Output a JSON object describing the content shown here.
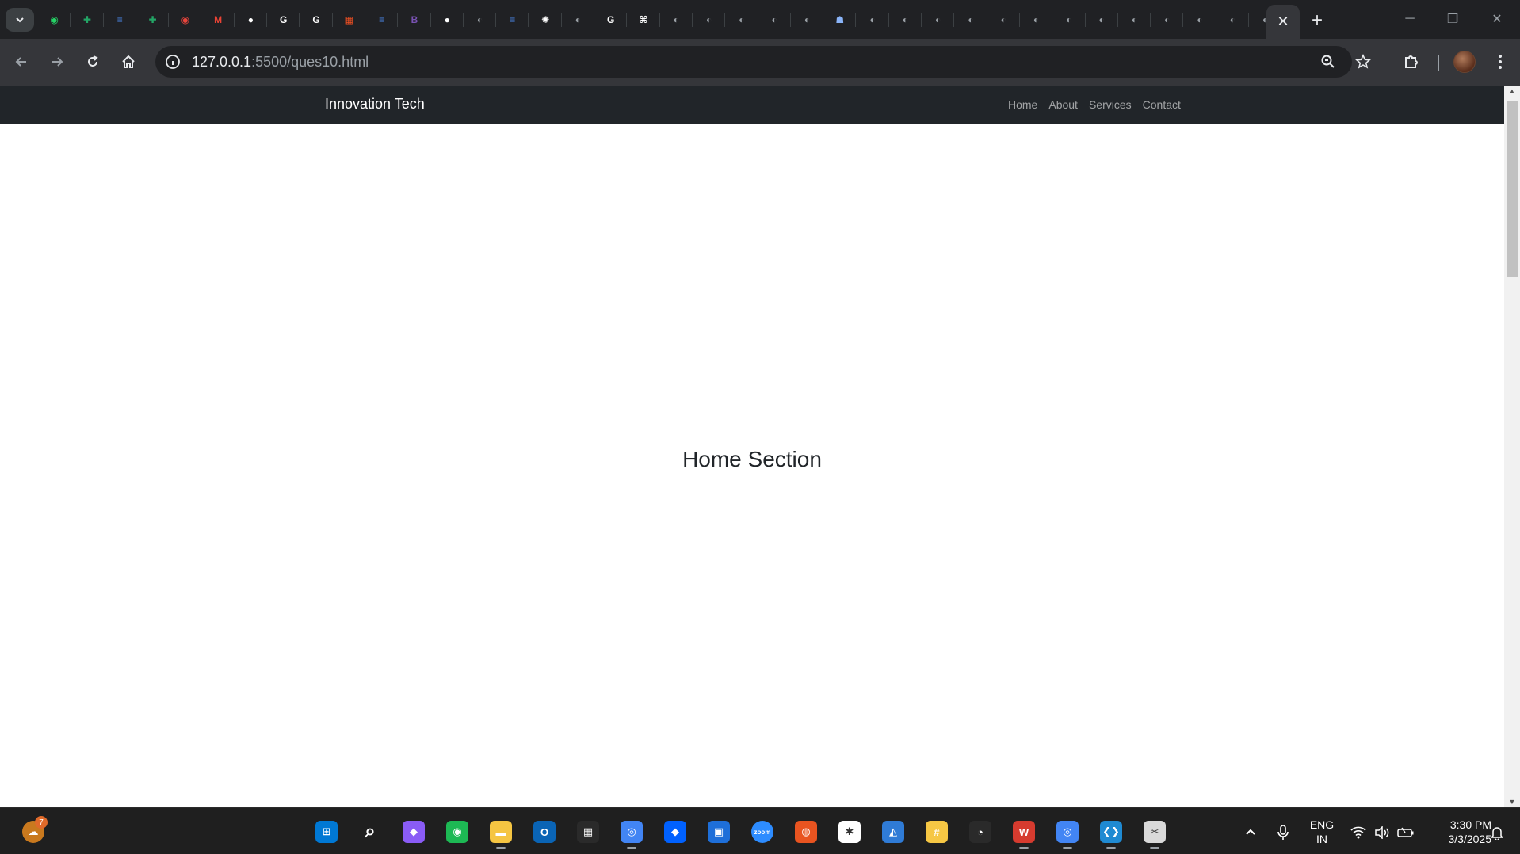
{
  "browser": {
    "active_tab_close_glyph": "✕",
    "new_tab_glyph": "+",
    "window_controls": {
      "minimize": "─",
      "restore": "❐",
      "close": "✕"
    },
    "pinned_tabs": [
      {
        "icon": "whatsapp-icon",
        "color": "#25d366",
        "glyph": "◉"
      },
      {
        "icon": "sheets-icon",
        "color": "#23a566",
        "glyph": "✚"
      },
      {
        "icon": "docs-icon",
        "color": "#4a86e8",
        "glyph": "≡"
      },
      {
        "icon": "sheets-icon",
        "color": "#23a566",
        "glyph": "✚"
      },
      {
        "icon": "record-icon",
        "color": "#e8453c",
        "glyph": "◉"
      },
      {
        "icon": "gmail-icon",
        "color": "#ea4335",
        "glyph": "M"
      },
      {
        "icon": "github-icon",
        "color": "#ffffff",
        "glyph": "●"
      },
      {
        "icon": "google-icon",
        "color": "#ffffff",
        "glyph": "G"
      },
      {
        "icon": "google-icon",
        "color": "#ffffff",
        "glyph": "G"
      },
      {
        "icon": "microsoft-icon",
        "color": "#f25022",
        "glyph": "▦"
      },
      {
        "icon": "docs-icon",
        "color": "#4a86e8",
        "glyph": "≡"
      },
      {
        "icon": "bootstrap-icon",
        "color": "#7952b3",
        "glyph": "B"
      },
      {
        "icon": "github-icon",
        "color": "#ffffff",
        "glyph": "●"
      },
      {
        "icon": "globe-icon",
        "color": "#9aa0a6",
        "glyph": "◐"
      },
      {
        "icon": "docs-icon",
        "color": "#4a86e8",
        "glyph": "≡"
      },
      {
        "icon": "openai-icon",
        "color": "#ffffff",
        "glyph": "✺"
      },
      {
        "icon": "globe-icon",
        "color": "#9aa0a6",
        "glyph": "◐"
      },
      {
        "icon": "google-icon",
        "color": "#ffffff",
        "glyph": "G"
      },
      {
        "icon": "perplexity-icon",
        "color": "#ffffff",
        "glyph": "⌘"
      },
      {
        "icon": "globe-icon",
        "color": "#9aa0a6",
        "glyph": "◐"
      },
      {
        "icon": "globe-icon",
        "color": "#9aa0a6",
        "glyph": "◐"
      },
      {
        "icon": "globe-icon",
        "color": "#9aa0a6",
        "glyph": "◐"
      },
      {
        "icon": "globe-icon",
        "color": "#9aa0a6",
        "glyph": "◐"
      },
      {
        "icon": "globe-icon",
        "color": "#9aa0a6",
        "glyph": "◐"
      },
      {
        "icon": "robot-icon",
        "color": "#8ab4f8",
        "glyph": "☗"
      },
      {
        "icon": "globe-icon",
        "color": "#9aa0a6",
        "glyph": "◐"
      },
      {
        "icon": "globe-icon",
        "color": "#9aa0a6",
        "glyph": "◐"
      },
      {
        "icon": "globe-icon",
        "color": "#9aa0a6",
        "glyph": "◐"
      },
      {
        "icon": "globe-icon",
        "color": "#9aa0a6",
        "glyph": "◐"
      },
      {
        "icon": "globe-icon",
        "color": "#9aa0a6",
        "glyph": "◐"
      },
      {
        "icon": "globe-icon",
        "color": "#9aa0a6",
        "glyph": "◐"
      },
      {
        "icon": "globe-icon",
        "color": "#9aa0a6",
        "glyph": "◐"
      },
      {
        "icon": "globe-icon",
        "color": "#9aa0a6",
        "glyph": "◐"
      },
      {
        "icon": "globe-icon",
        "color": "#9aa0a6",
        "glyph": "◐"
      },
      {
        "icon": "globe-icon",
        "color": "#9aa0a6",
        "glyph": "◐"
      },
      {
        "icon": "globe-icon",
        "color": "#9aa0a6",
        "glyph": "◐"
      },
      {
        "icon": "globe-icon",
        "color": "#9aa0a6",
        "glyph": "◐"
      },
      {
        "icon": "globe-icon",
        "color": "#9aa0a6",
        "glyph": "◐"
      }
    ],
    "address_bar": {
      "host": "127.0.0.1",
      "path": ":5500/ques10.html"
    }
  },
  "page": {
    "brand": "Innovation Tech",
    "nav_links": [
      "Home",
      "About",
      "Services",
      "Contact"
    ],
    "section_title": "Home Section"
  },
  "taskbar": {
    "widgets_badge": "7",
    "apps": [
      {
        "name": "start-icon",
        "color": "#0078d4",
        "glyph": "⊞"
      },
      {
        "name": "search-icon",
        "color": "transparent",
        "glyph": "⌕"
      },
      {
        "name": "copilot-icon",
        "color": "#8a5cf6",
        "glyph": "◆"
      },
      {
        "name": "spotify-icon",
        "color": "#1db954",
        "glyph": "◉"
      },
      {
        "name": "file-explorer-icon",
        "color": "#f5c542",
        "glyph": "▬"
      },
      {
        "name": "outlook-icon",
        "color": "#0a64b5",
        "glyph": "O"
      },
      {
        "name": "store-icon",
        "color": "#2a2a2a",
        "glyph": "▦"
      },
      {
        "name": "chrome-icon",
        "color": "#4285f4",
        "glyph": "◎"
      },
      {
        "name": "dropbox-icon",
        "color": "#0061ff",
        "glyph": "◆"
      },
      {
        "name": "app-icon",
        "color": "#1e6fd9",
        "glyph": "▣"
      },
      {
        "name": "zoom-icon",
        "color": "#2d8cff",
        "glyph": "zoom"
      },
      {
        "name": "ubuntu-icon",
        "color": "#e95420",
        "glyph": "◍"
      },
      {
        "name": "slack-icon",
        "color": "#ffffff",
        "glyph": "✱"
      },
      {
        "name": "azure-icon",
        "color": "#2f7bd6",
        "glyph": "◭"
      },
      {
        "name": "notes-icon",
        "color": "#f6c744",
        "glyph": "#"
      },
      {
        "name": "recorder-icon",
        "color": "#2a2a2a",
        "glyph": "◔"
      },
      {
        "name": "wps-icon",
        "color": "#d63b2f",
        "glyph": "W"
      },
      {
        "name": "chrome-profile-icon",
        "color": "#4285f4",
        "glyph": "◎"
      },
      {
        "name": "vscode-icon",
        "color": "#1f8ad2",
        "glyph": "❮❯"
      },
      {
        "name": "snipping-icon",
        "color": "#d9d9d9",
        "glyph": "✂"
      }
    ],
    "tray": {
      "lang_line1": "ENG",
      "lang_line2": "IN",
      "time": "3:30 PM",
      "date": "3/3/2025"
    }
  }
}
